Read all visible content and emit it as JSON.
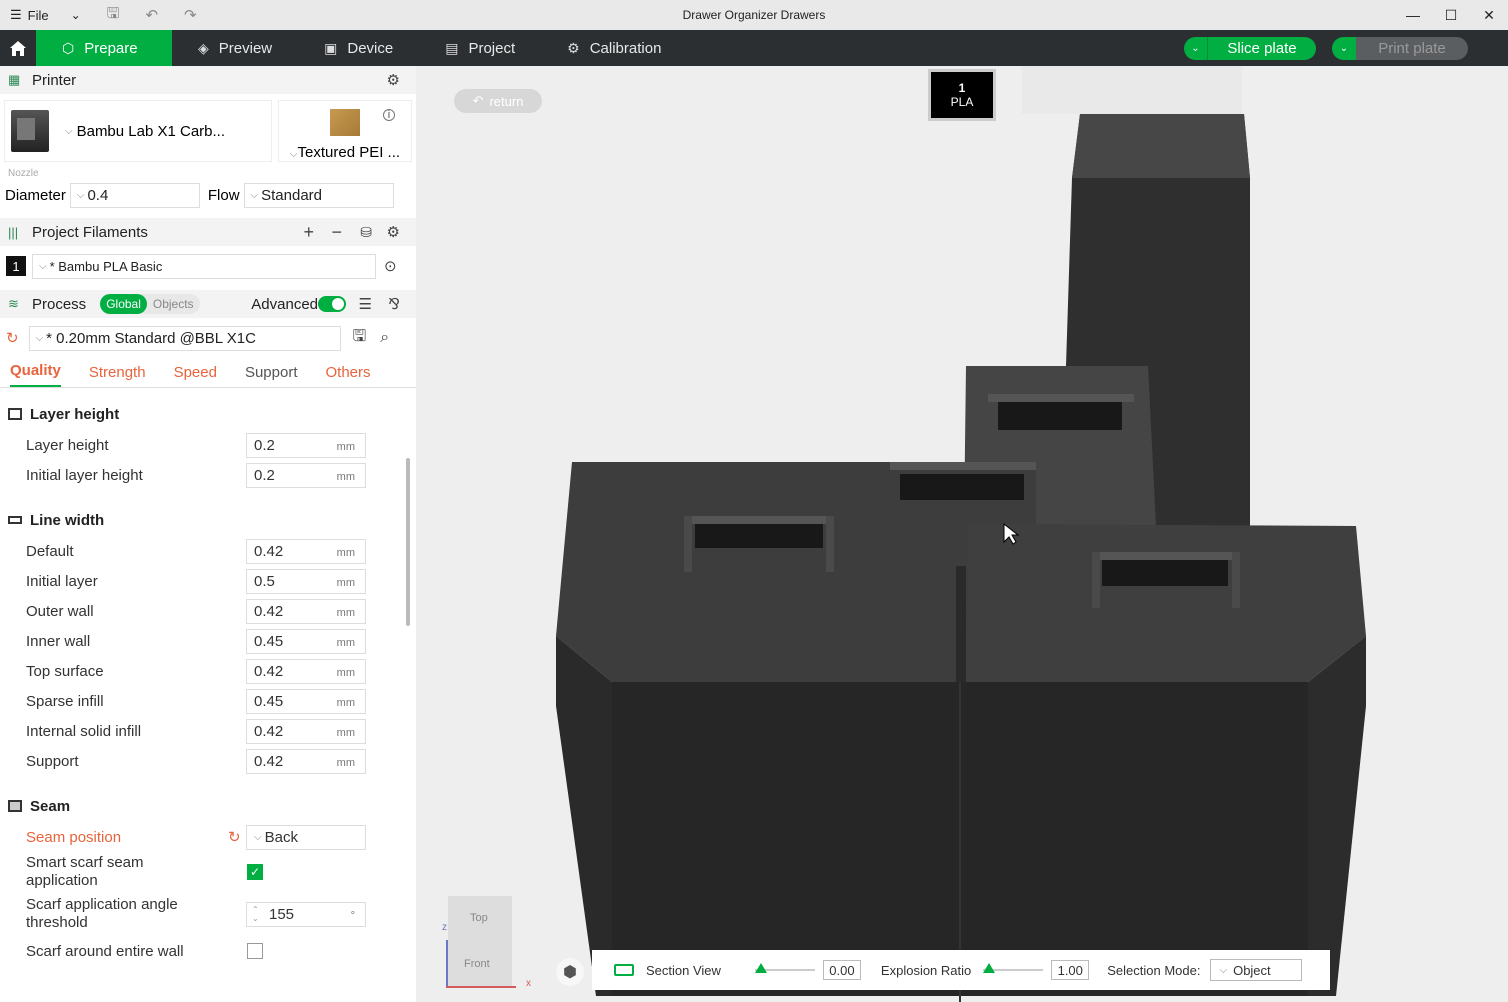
{
  "titlebar": {
    "file_label": "File",
    "title": "Drawer Organizer Drawers"
  },
  "nav": {
    "tabs": [
      {
        "label": "Prepare",
        "icon": "cube-icon"
      },
      {
        "label": "Preview",
        "icon": "layers-icon"
      },
      {
        "label": "Device",
        "icon": "device-icon"
      },
      {
        "label": "Project",
        "icon": "project-icon"
      },
      {
        "label": "Calibration",
        "icon": "calibration-icon"
      }
    ],
    "slice_label": "Slice plate",
    "print_label": "Print plate"
  },
  "printer": {
    "section_title": "Printer",
    "name": "Bambu Lab X1 Carb...",
    "plate": "Textured PEI ...",
    "nozzle_label": "Nozzle",
    "diameter_label": "Diameter",
    "diameter_value": "0.4",
    "flow_label": "Flow",
    "flow_value": "Standard"
  },
  "filaments": {
    "section_title": "Project Filaments",
    "items": [
      {
        "index": "1",
        "name": "* Bambu PLA Basic"
      }
    ]
  },
  "process": {
    "section_title": "Process",
    "global_label": "Global",
    "objects_label": "Objects",
    "advanced_label": "Advanced",
    "preset": "* 0.20mm Standard @BBL X1C",
    "tabs": [
      "Quality",
      "Strength",
      "Speed",
      "Support",
      "Others"
    ]
  },
  "groups": {
    "layer_height": {
      "title": "Layer height",
      "options": [
        {
          "label": "Layer height",
          "value": "0.2",
          "unit": "mm"
        },
        {
          "label": "Initial layer height",
          "value": "0.2",
          "unit": "mm"
        }
      ]
    },
    "line_width": {
      "title": "Line width",
      "options": [
        {
          "label": "Default",
          "value": "0.42",
          "unit": "mm"
        },
        {
          "label": "Initial layer",
          "value": "0.5",
          "unit": "mm"
        },
        {
          "label": "Outer wall",
          "value": "0.42",
          "unit": "mm"
        },
        {
          "label": "Inner wall",
          "value": "0.45",
          "unit": "mm"
        },
        {
          "label": "Top surface",
          "value": "0.42",
          "unit": "mm"
        },
        {
          "label": "Sparse infill",
          "value": "0.45",
          "unit": "mm"
        },
        {
          "label": "Internal solid infill",
          "value": "0.42",
          "unit": "mm"
        },
        {
          "label": "Support",
          "value": "0.42",
          "unit": "mm"
        }
      ]
    },
    "seam": {
      "title": "Seam",
      "seam_position_label": "Seam position",
      "seam_position_value": "Back",
      "smart_scarf_label": "Smart scarf seam application",
      "scarf_angle_label": "Scarf application angle threshold",
      "scarf_angle_value": "155",
      "scarf_angle_unit": "°",
      "scarf_entire_wall_label": "Scarf around entire wall"
    }
  },
  "canvas": {
    "return_label": "return",
    "plate_number": "1",
    "plate_material": "PLA",
    "view_top": "Top",
    "view_front": "Front",
    "axis_z": "z",
    "axis_x": "x",
    "section_view_label": "Section View",
    "section_value": "0.00",
    "explosion_label": "Explosion Ratio",
    "explosion_value": "1.00",
    "selection_mode_label": "Selection Mode:",
    "selection_mode_value": "Object"
  },
  "colors": {
    "accent": "#00ae42",
    "nav_bg": "#2b2f32",
    "warn": "#e8643c",
    "model": "#333333"
  }
}
